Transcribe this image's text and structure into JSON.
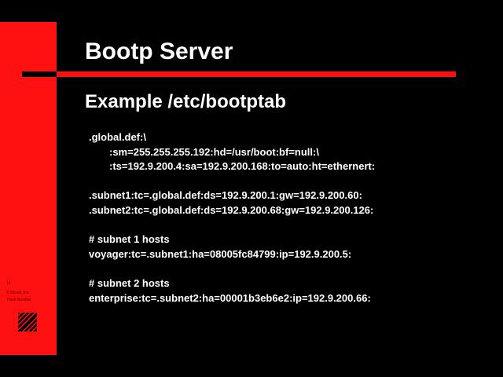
{
  "slide": {
    "title": "Bootp Server",
    "subtitle": "Example /etc/bootptab",
    "code_lines": [
      ".global.def:\\",
      ":sm=255.255.255.192:hd=/usr/boot:bf=null:\\",
      ":ts=192.9.200.4:sa=192.9.200.168:to=auto:ht=ethernert:",
      ".subnet1:tc=.global.def:ds=192.9.200.1:gw=192.9.200.60:",
      ".subnet2:tc=.global.def:ds=192.9.200.68:gw=192.9.200.126:",
      "# subnet 1 hosts",
      "voyager:tc=.subnet1:ha=08005fc84799:ip=192.9.200.5:",
      "# subnet 2 hosts",
      "enterprise:tc=.subnet2:ha=00001b3eb6e2:ip=192.9.200.66:"
    ]
  },
  "sidebar": {
    "page_number": "14",
    "copyright": "© Novell, Inc.",
    "track": "Track Number",
    "logo_icon": "novell-logo-icon"
  },
  "colors": {
    "background": "#000000",
    "accent_red": "#ff1010",
    "text": "#ffffff"
  }
}
